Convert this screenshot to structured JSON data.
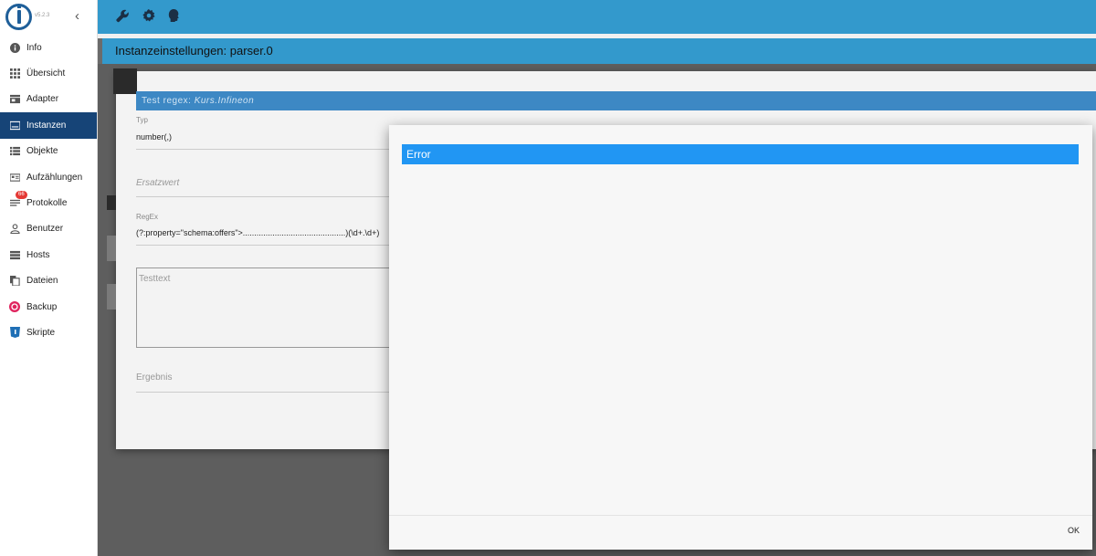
{
  "sidebar": {
    "version": "v5.2.3",
    "items": [
      {
        "label": "Info",
        "icon": "info-icon"
      },
      {
        "label": "Übersicht",
        "icon": "grid-icon"
      },
      {
        "label": "Adapter",
        "icon": "store-icon"
      },
      {
        "label": "Instanzen",
        "icon": "instances-icon",
        "active": true
      },
      {
        "label": "Objekte",
        "icon": "list-icon"
      },
      {
        "label": "Aufzählungen",
        "icon": "enum-icon"
      },
      {
        "label": "Protokolle",
        "icon": "log-icon",
        "badge": "66"
      },
      {
        "label": "Benutzer",
        "icon": "user-icon"
      },
      {
        "label": "Hosts",
        "icon": "hosts-icon"
      },
      {
        "label": "Dateien",
        "icon": "files-icon"
      },
      {
        "label": "Backup",
        "icon": "backup-icon"
      },
      {
        "label": "Skripte",
        "icon": "scripts-icon"
      }
    ]
  },
  "topbar": {
    "icons": [
      "wrench-icon",
      "gear-icon",
      "expert-head-icon"
    ]
  },
  "title": "Instanzeinstellungen: parser.0",
  "test_dialog": {
    "header_prefix": "Test regex:",
    "header_name": "Kurs.Infineon",
    "typ_label": "Typ",
    "typ_value": "number(,)",
    "ersatzwert_label": "Ersatzwert",
    "regex_label": "RegEx",
    "regex_value": "(?:property=\"schema:offers\">.............................................)(\\d+.\\d+)",
    "testtext_placeholder": "Testtext",
    "ergebnis_label": "Ergebnis"
  },
  "error_dialog": {
    "title": "Error",
    "ok_label": "OK"
  },
  "colors": {
    "topbar": "#3399cc",
    "sidebar_active": "#164477",
    "error_header": "#2196f3",
    "badge": "#e53935"
  }
}
